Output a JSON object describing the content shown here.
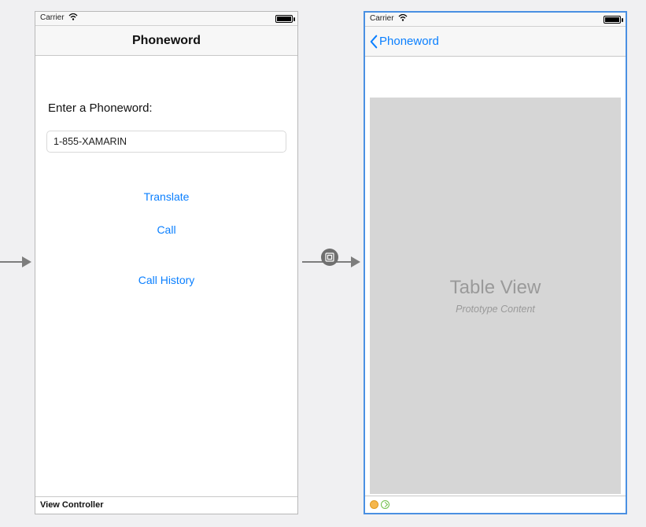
{
  "statusbar": {
    "carrier": "Carrier"
  },
  "screen1": {
    "title": "Phoneword",
    "promptLabel": "Enter a Phoneword:",
    "inputValue": "1-855-XAMARIN",
    "translateBtn": "Translate",
    "callBtn": "Call",
    "historyBtn": "Call History",
    "footer": "View Controller"
  },
  "screen2": {
    "backLabel": "Phoneword",
    "tableTitle": "Table View",
    "tableSubtitle": "Prototype Content"
  }
}
